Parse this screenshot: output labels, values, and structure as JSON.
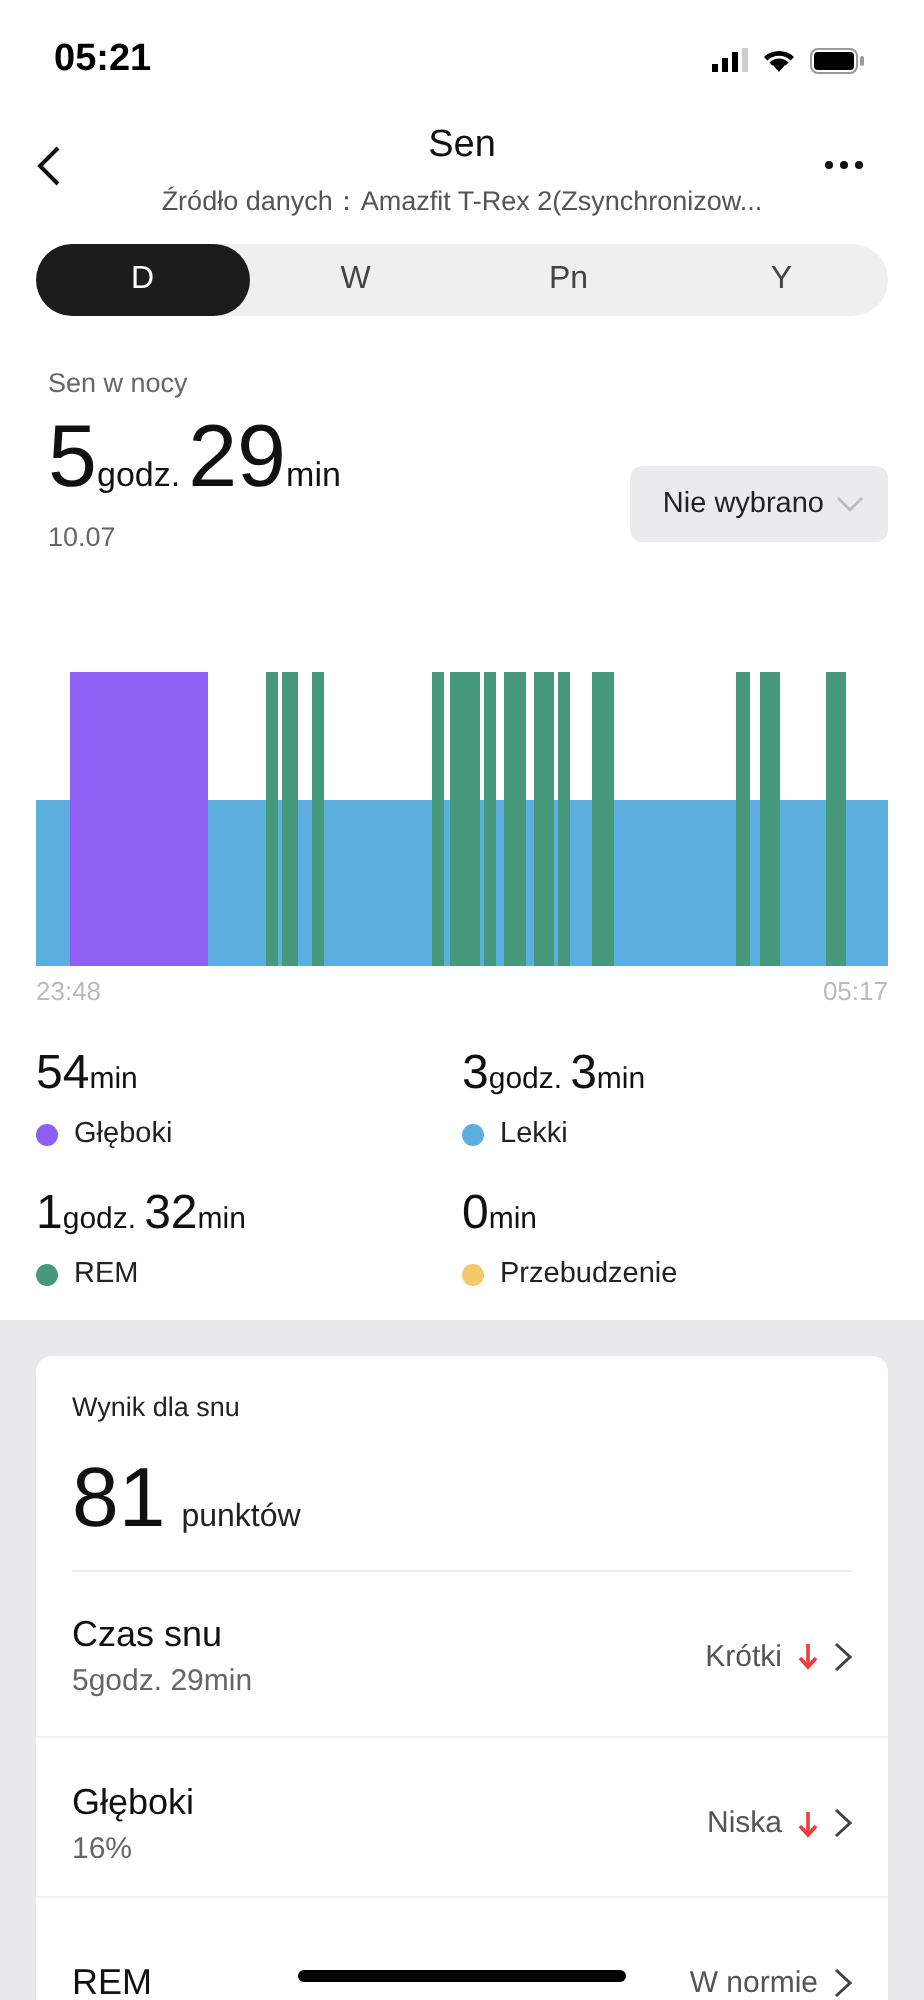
{
  "status_bar": {
    "time": "05:21"
  },
  "header": {
    "title": "Sen",
    "subtitle": "Źródło danych：Amazfit T-Rex 2(Zsynchronizow..."
  },
  "tabs": [
    {
      "label": "D",
      "selected": true
    },
    {
      "label": "W",
      "selected": false
    },
    {
      "label": "Pn",
      "selected": false
    },
    {
      "label": "Y",
      "selected": false
    }
  ],
  "summary": {
    "label": "Sen w nocy",
    "duration": [
      {
        "num": "5",
        "unit": "godz."
      },
      {
        "num": "29",
        "unit": "min"
      }
    ],
    "date": "10.07",
    "dropdown": "Nie wybrano"
  },
  "chart": {
    "start": "23:48",
    "end": "05:17"
  },
  "stages": [
    {
      "duration": [
        {
          "num": "54",
          "unit": "min"
        }
      ],
      "label": "Głęboki",
      "color": "#8f5ef2"
    },
    {
      "duration": [
        {
          "num": "3",
          "unit": "godz."
        },
        {
          "num": "3",
          "unit": "min"
        }
      ],
      "label": "Lekki",
      "color": "#5baede"
    },
    {
      "duration": [
        {
          "num": "1",
          "unit": "godz."
        },
        {
          "num": "32",
          "unit": "min"
        }
      ],
      "label": "REM",
      "color": "#46987a"
    },
    {
      "duration": [
        {
          "num": "0",
          "unit": "min"
        }
      ],
      "label": "Przebudzenie",
      "color": "#f3c96b"
    }
  ],
  "score_card": {
    "title": "Wynik dla snu",
    "score": "81",
    "unit": "punktów",
    "rows": [
      {
        "label": "Czas snu",
        "value": "5godz. 29min",
        "status": "Krótki",
        "arrow_down": true
      },
      {
        "label": "Głęboki",
        "value": "16%",
        "status": "Niska",
        "arrow_down": true
      },
      {
        "label": "REM",
        "status": "W normie",
        "arrow_down": false
      }
    ]
  }
}
